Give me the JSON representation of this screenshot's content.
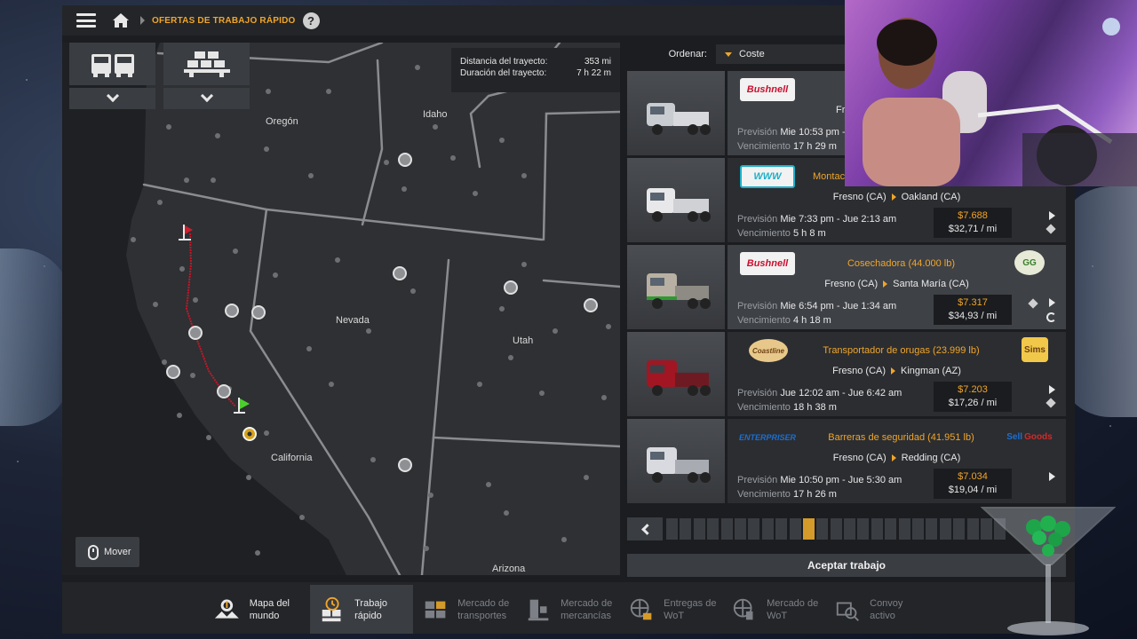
{
  "header": {
    "breadcrumb": "OFERTAS DE TRABAJO RÁPIDO",
    "help": "?"
  },
  "map": {
    "route_info": {
      "distance_label": "Distancia del trayecto:",
      "distance_value": "353 mi",
      "duration_label": "Duración del trayecto:",
      "duration_value": "7 h 22 m"
    },
    "states": [
      "Oregón",
      "Idaho",
      "Nevada",
      "Utah",
      "California",
      "Arizona"
    ],
    "move_button": "Mover"
  },
  "sort": {
    "label": "Ordenar:",
    "value": "Coste"
  },
  "jobs": [
    {
      "company": "Bushnell",
      "cargo": "",
      "route_from": "Fr",
      "route_to": "",
      "forecast_label": "Previsión",
      "forecast": "Mie 10:53 pm -",
      "expiry_label": "Vencimiento",
      "expiry": "17 h 29 m",
      "pay": "",
      "pay_per_mi": ""
    },
    {
      "company": "WWW",
      "cargo": "Montac",
      "route_from": "Fresno (CA)",
      "route_to": "Oakland (CA)",
      "forecast_label": "Previsión",
      "forecast": "Mie 7:33 pm - Jue 2:13 am",
      "expiry_label": "Vencimiento",
      "expiry": "5 h 8 m",
      "pay": "$7.688",
      "pay_per_mi": "$32,71 / mi"
    },
    {
      "company": "Bushnell",
      "cargo": "Cosechadora (44.000 lb)",
      "route_from": "Fresno (CA)",
      "route_to": "Santa María (CA)",
      "forecast_label": "Previsión",
      "forecast": "Mie 6:54 pm - Jue 1:34 am",
      "expiry_label": "Vencimiento",
      "expiry": "4 h 18 m",
      "pay": "$7.317",
      "pay_per_mi": "$34,93 / mi"
    },
    {
      "company": "Coastline",
      "cargo": "Transportador de orugas (23.999 lb)",
      "route_from": "Fresno (CA)",
      "route_to": "Kingman (AZ)",
      "forecast_label": "Previsión",
      "forecast": "Jue 12:02 am - Jue 6:42 am",
      "expiry_label": "Vencimiento",
      "expiry": "18 h 38 m",
      "pay": "$7.203",
      "pay_per_mi": "$17,26 / mi"
    },
    {
      "company": "ENTERPRISER",
      "cargo": "Barreras de seguridad (41.951 lb)",
      "route_from": "Fresno (CA)",
      "route_to": "Redding (CA)",
      "forecast_label": "Previsión",
      "forecast": "Mie 10:50 pm - Jue 5:30 am",
      "expiry_label": "Vencimiento",
      "expiry": "17 h 26 m",
      "pay": "$7.034",
      "pay_per_mi": "$19,04 / mi"
    }
  ],
  "client_logos": {
    "job3": "GG",
    "job4": "Sims",
    "job5_a": "Sell",
    "job5_b": "Goods"
  },
  "pager": {
    "total": 25,
    "active_index": 10
  },
  "accept_button": "Aceptar trabajo",
  "bottom_nav": [
    {
      "l1": "Mapa del",
      "l2": "mundo",
      "icon": "world-map-icon"
    },
    {
      "l1": "Trabajo",
      "l2": "rápido",
      "icon": "quick-job-icon"
    },
    {
      "l1": "Mercado de",
      "l2": "transportes",
      "icon": "freight-market-icon"
    },
    {
      "l1": "Mercado de",
      "l2": "mercancías",
      "icon": "cargo-market-icon"
    },
    {
      "l1": "Entregas de",
      "l2": "WoT",
      "icon": "wot-deliveries-icon"
    },
    {
      "l1": "Mercado de",
      "l2": "WoT",
      "icon": "wot-market-icon"
    },
    {
      "l1": "Convoy",
      "l2": "activo",
      "icon": "convoy-icon"
    }
  ],
  "colors": {
    "accent": "#f0a52a",
    "route": "#c0182a"
  }
}
